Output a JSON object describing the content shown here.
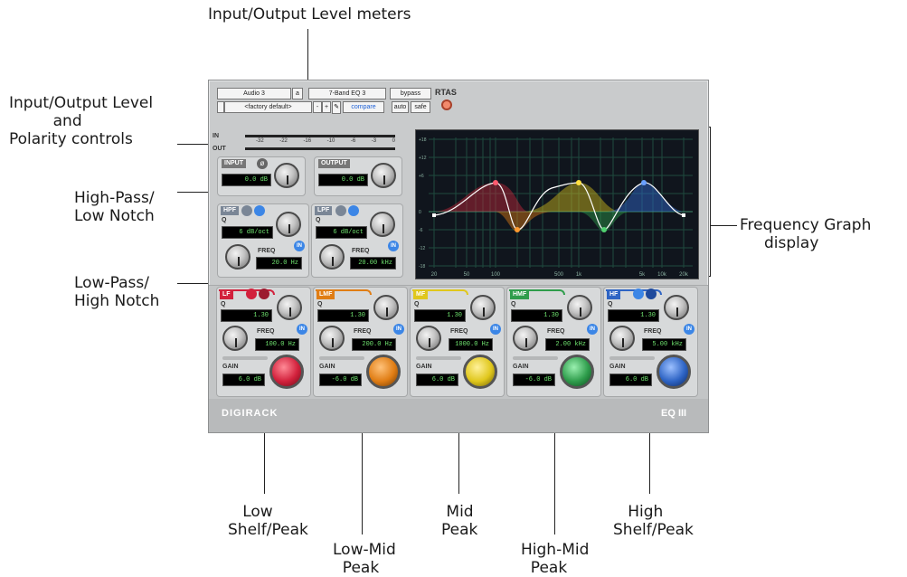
{
  "callouts": {
    "io_meters": "Input/Output Level meters",
    "io_level_polarity": "Input/Output Level\n         and\nPolarity controls",
    "hpf": "High-Pass/\nLow Notch",
    "lpf": "Low-Pass/\nHigh Notch",
    "freq_graph": "Frequency Graph\n     display",
    "low_shelf": "   Low\nShelf/Peak",
    "low_mid": "Low-Mid\n  Peak",
    "mid": " Mid\nPeak",
    "high_mid": "High-Mid\n  Peak",
    "high_shelf": "   High\nShelf/Peak"
  },
  "header": {
    "track": "Audio 3",
    "slot": "a",
    "plugin_name": "7-Band EQ 3",
    "bypass": "bypass",
    "format": "RTAS",
    "preset_toggle": "",
    "preset": "<factory default>",
    "minus": "-",
    "plus": "+",
    "compare": "compare",
    "auto": "auto",
    "safe": "safe"
  },
  "meters": {
    "in_label": "IN",
    "out_label": "OUT",
    "scale": [
      "-32",
      "-22",
      "-16",
      "-10",
      "-6",
      "-3",
      "0"
    ]
  },
  "input": {
    "label": "INPUT",
    "value": "0.0 dB"
  },
  "output": {
    "label": "OUTPUT",
    "value": "0.0 dB"
  },
  "hpf": {
    "tag": "HPF",
    "q_label": "Q",
    "q_value": "6 dB/oct",
    "freq_label": "FREQ",
    "freq_value": "20.0 Hz",
    "in": "IN"
  },
  "lpf": {
    "tag": "LPF",
    "q_label": "Q",
    "q_value": "6 dB/oct",
    "freq_label": "FREQ",
    "freq_value": "20.00 kHz",
    "in": "IN"
  },
  "graph": {
    "y_ticks": [
      "+18",
      "+12",
      "+6",
      "0",
      "-6",
      "-12",
      "-18"
    ],
    "x_ticks": [
      "20",
      "50",
      "100",
      "500",
      "1k",
      "5k",
      "10k",
      "20k"
    ]
  },
  "bands": [
    {
      "tag": "LF",
      "color": "#d2213c",
      "q_label": "Q",
      "q_value": "1.30",
      "freq_label": "FREQ",
      "freq_value": "100.0 Hz",
      "gain_label": "GAIN",
      "gain_value": "6.0 dB",
      "in": "IN"
    },
    {
      "tag": "LMF",
      "color": "#e07d14",
      "q_label": "Q",
      "q_value": "1.30",
      "freq_label": "FREQ",
      "freq_value": "200.0 Hz",
      "gain_label": "GAIN",
      "gain_value": "-6.0 dB",
      "in": "IN"
    },
    {
      "tag": "MF",
      "color": "#e0c71c",
      "q_label": "Q",
      "q_value": "1.30",
      "freq_label": "FREQ",
      "freq_value": "1000.0 Hz",
      "gain_label": "GAIN",
      "gain_value": "6.0 dB",
      "in": "IN"
    },
    {
      "tag": "HMF",
      "color": "#2f9d4c",
      "q_label": "Q",
      "q_value": "1.30",
      "freq_label": "FREQ",
      "freq_value": "2.00 kHz",
      "gain_label": "GAIN",
      "gain_value": "-6.0 dB",
      "in": "IN"
    },
    {
      "tag": "HF",
      "color": "#2e64c4",
      "q_label": "Q",
      "q_value": "1.30",
      "freq_label": "FREQ",
      "freq_value": "5.00 kHz",
      "gain_label": "GAIN",
      "gain_value": "6.0 dB",
      "in": "IN"
    }
  ],
  "footer": {
    "brand": "DIGIRACK",
    "product": "EQ III"
  }
}
